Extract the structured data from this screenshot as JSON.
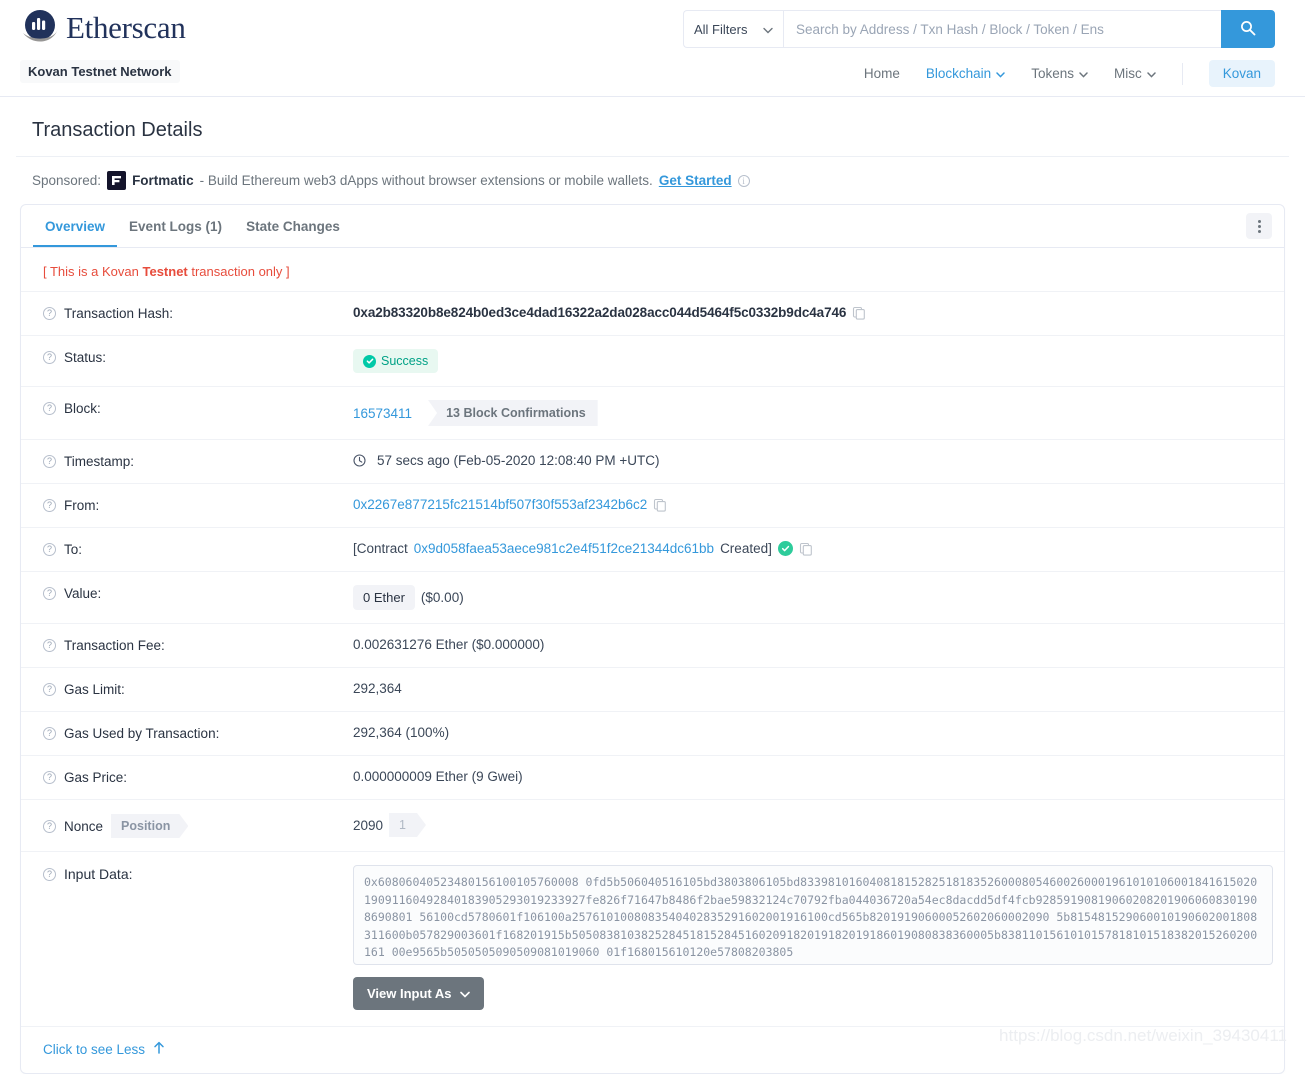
{
  "header": {
    "brand_name": "Etherscan",
    "brand_logo_icon": "etherscan-logo-icon",
    "network_badge": "Kovan Testnet Network",
    "search": {
      "filter_label": "All Filters",
      "placeholder": "Search by Address / Txn Hash / Block / Token / Ens",
      "value": "",
      "search_icon": "search-icon",
      "chevron_icon": "chevron-down-icon"
    },
    "nav": [
      {
        "label": "Home",
        "has_caret": false,
        "active": false
      },
      {
        "label": "Blockchain",
        "has_caret": true,
        "active": true
      },
      {
        "label": "Tokens",
        "has_caret": true,
        "active": false
      },
      {
        "label": "Misc",
        "has_caret": true,
        "active": false
      }
    ],
    "network_pill": "Kovan"
  },
  "page": {
    "title": "Transaction Details"
  },
  "sponsored": {
    "prefix": "Sponsored:",
    "logo_icon": "fortmatic-logo-icon",
    "name": "Fortmatic",
    "text": "- Build Ethereum web3 dApps without browser extensions or mobile wallets.",
    "cta": "Get Started",
    "info_icon": "info-icon"
  },
  "tabs": [
    {
      "label": "Overview",
      "active": true
    },
    {
      "label": "Event Logs (1)",
      "active": false
    },
    {
      "label": "State Changes",
      "active": false
    }
  ],
  "kebab_menu_icon": "more-vertical-icon",
  "testnet_note": {
    "prefix": "[ This is a Kovan ",
    "emphasis": "Testnet",
    "suffix": " transaction only ]"
  },
  "details": {
    "transaction_hash": {
      "label": "Transaction Hash:",
      "value": "0xa2b83320b8e824b0ed3ce4dad16322a2da028acc044d5464f5c0332b9dc4a746",
      "copy_icon": "copy-icon"
    },
    "status": {
      "label": "Status:",
      "value": "Success",
      "icon": "check-circle-icon"
    },
    "block": {
      "label": "Block:",
      "number": "16573411",
      "confirmations": "13 Block Confirmations"
    },
    "timestamp": {
      "label": "Timestamp:",
      "clock_icon": "clock-icon",
      "value": "57 secs ago (Feb-05-2020 12:08:40 PM +UTC)"
    },
    "from": {
      "label": "From:",
      "address": "0x2267e877215fc21514bf507f30f553af2342b6c2",
      "copy_icon": "copy-icon"
    },
    "to": {
      "label": "To:",
      "prefix": "[Contract",
      "address": "0x9d058faea53aece981c2e4f51f2ce21344dc61bb",
      "suffix": "Created]",
      "verified_icon": "check-circle-icon",
      "copy_icon": "copy-icon"
    },
    "value": {
      "label": "Value:",
      "amount": "0 Ether",
      "fiat": "($0.00)"
    },
    "transaction_fee": {
      "label": "Transaction Fee:",
      "value": "0.002631276 Ether ($0.000000)"
    },
    "gas_limit": {
      "label": "Gas Limit:",
      "value": "292,364"
    },
    "gas_used": {
      "label": "Gas Used by Transaction:",
      "value": "292,364 (100%)"
    },
    "gas_price": {
      "label": "Gas Price:",
      "value": "0.000000009 Ether (9 Gwei)"
    },
    "nonce": {
      "label": "Nonce",
      "position_label": "Position",
      "nonce_value": "2090",
      "position_value": "1"
    },
    "input_data": {
      "label": "Input Data:",
      "value": "0x60806040523480156100105760008 0fd5b506040516105bd3803806105bd83398101604081815282518183526000805460026000196101010600184161502019091160492840183905293019233927fe826f71647b8486f2bae59832124c70792fba044036720a54ec8dacdd5df4fcb928591908190602082019060608301908690801 56100cd5780601f106100a2576101008083540402835291602001916100cd565b82019190600052602060002090 5b815481529060010190602001808311600b057829003601f168201915b5050838103825284518152845160209182019182019186019080838360005b8381101561010157818101518382015260200161 00e9565b5050505090509081019060 01f168015610120e57808203805",
      "view_input_as": "View Input As",
      "chevron_icon": "chevron-down-icon",
      "resize_icon": "resize-grip-icon"
    }
  },
  "footer": {
    "see_less": "Click to see Less",
    "arrow_icon": "arrow-up-icon"
  },
  "watermark": "https://blog.csdn.net/weixin_39430411",
  "colors": {
    "brand": "#21325b",
    "accent": "#3498db",
    "success": "#00a186",
    "danger": "#e74c3c",
    "muted": "#6c757d"
  }
}
